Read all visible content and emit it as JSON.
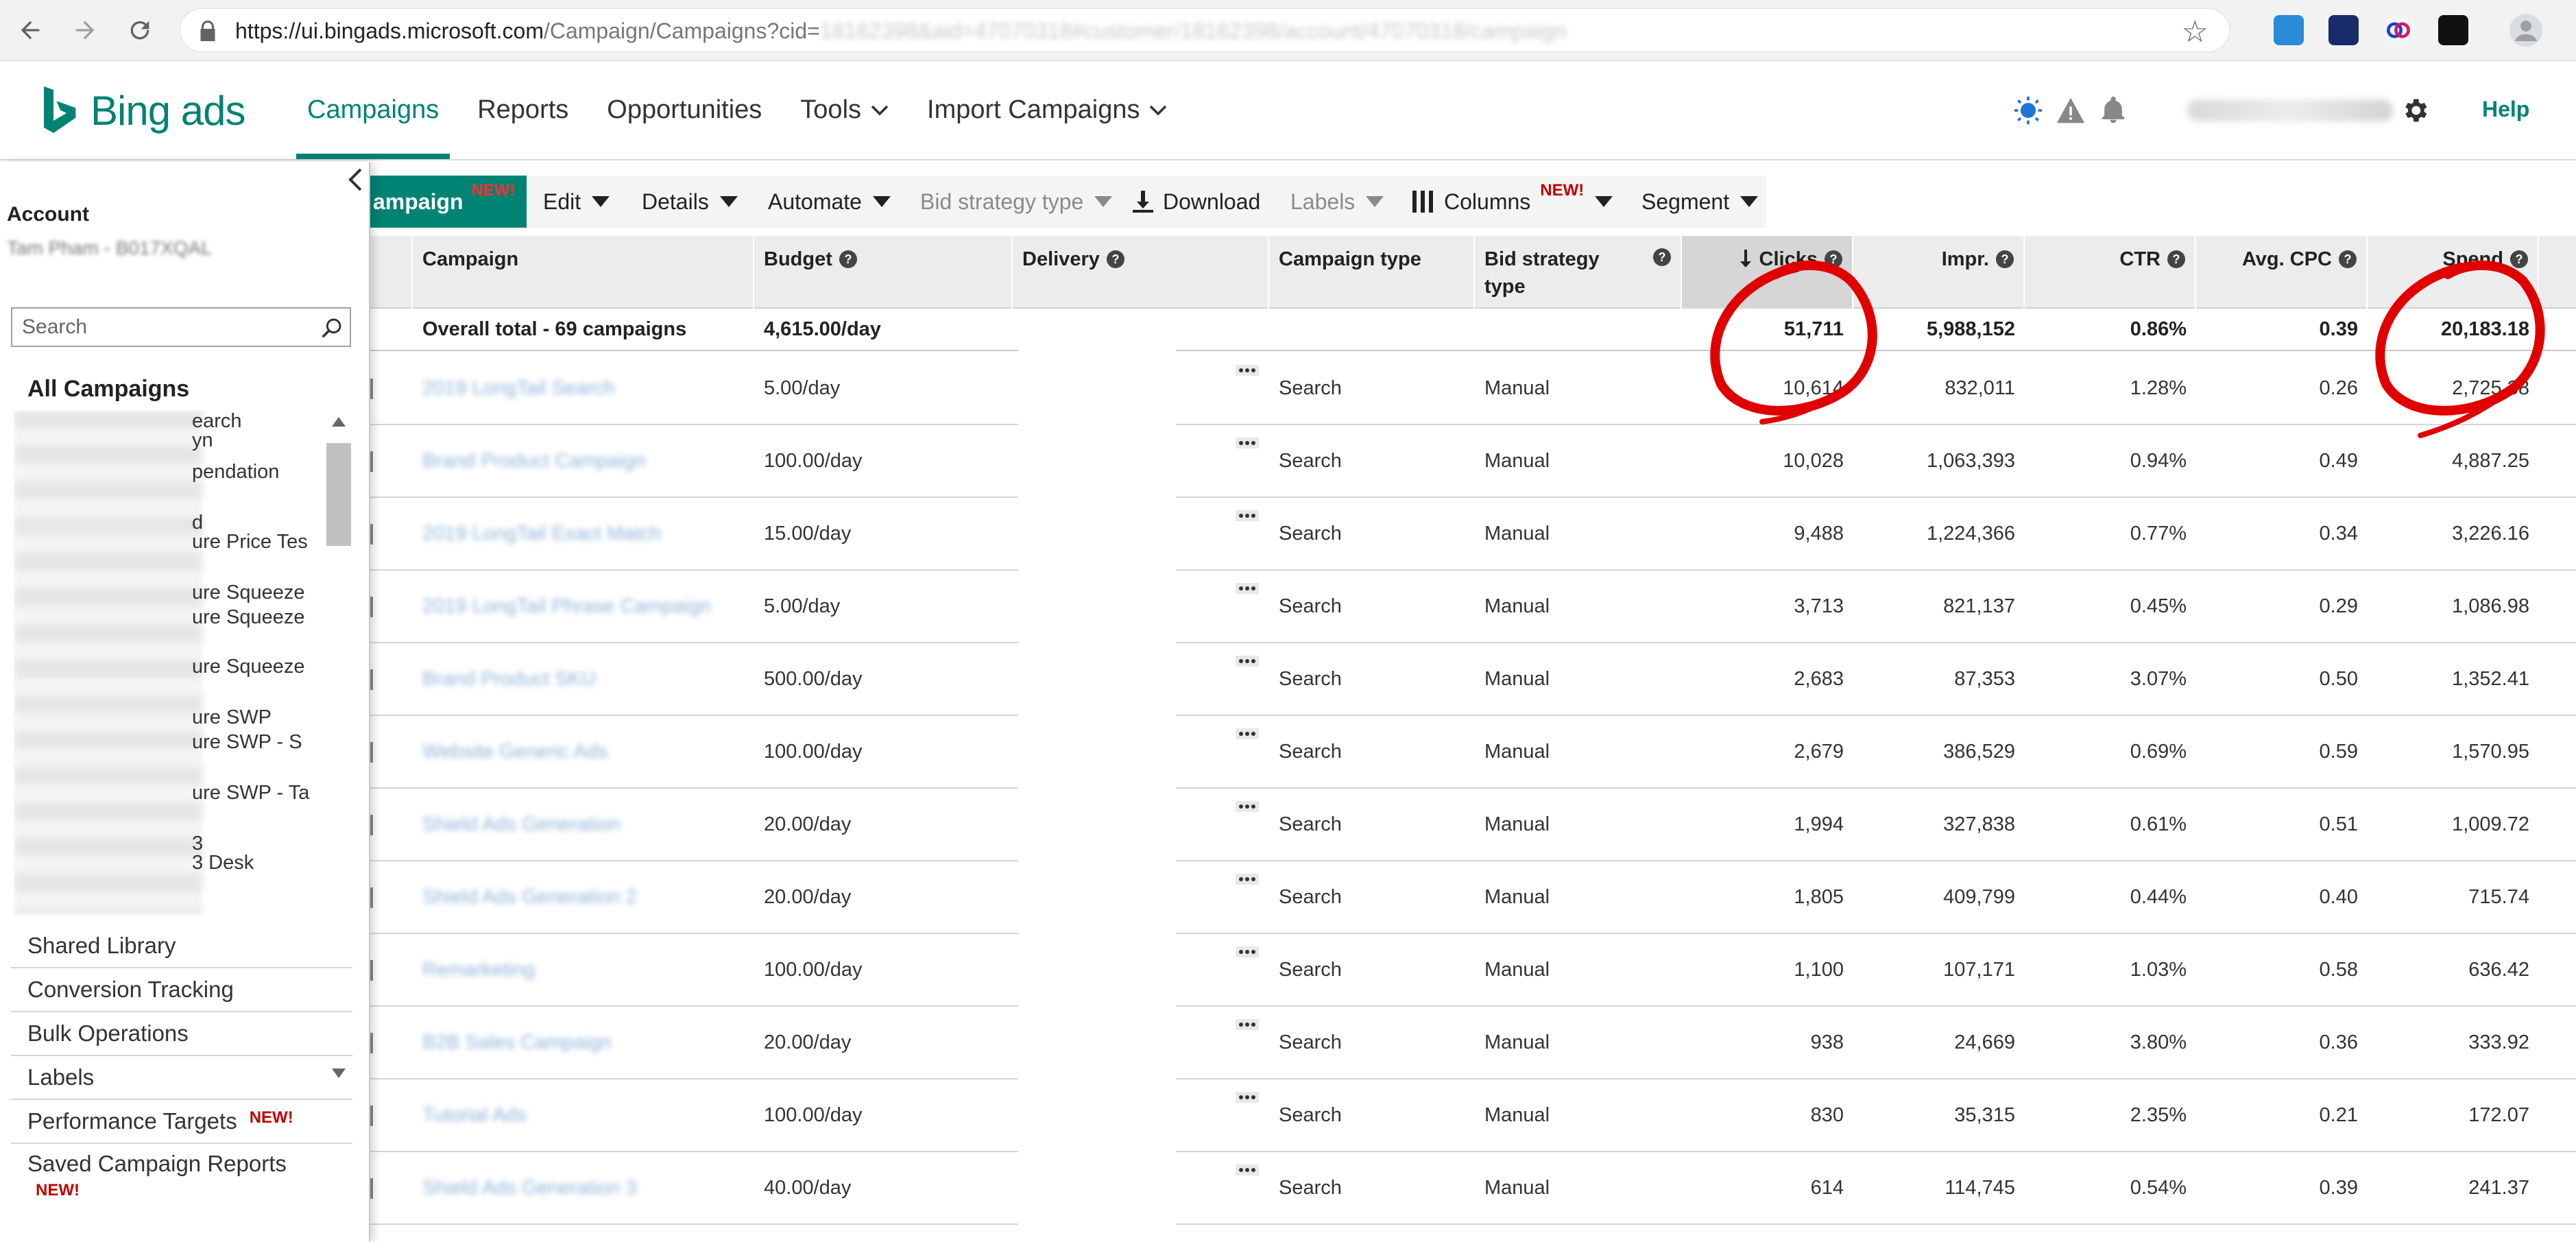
{
  "browser": {
    "url_main": "https://ui.bingads.microsoft.com",
    "url_path": "/Campaign/Campaigns?cid=",
    "url_blurred": "18162398&aid=47070318#customer/18162398/account/47070318/campaign"
  },
  "header": {
    "brand": "Bing ads",
    "nav": [
      {
        "label": "Campaigns"
      },
      {
        "label": "Reports"
      },
      {
        "label": "Opportunities"
      },
      {
        "label": "Tools"
      },
      {
        "label": "Import Campaigns"
      }
    ],
    "help": "Help"
  },
  "sidebar": {
    "account_label": "Account",
    "account_name": "Tam Pham - B017XQAL",
    "search_placeholder": "Search",
    "all_campaigns": "All Campaigns",
    "campaign_fragments": [
      "earch",
      "yn",
      "pendation",
      "d",
      "ure Price Tes",
      "ure Squeeze",
      "ure Squeeze",
      "ure Squeeze",
      "ure SWP",
      "ure SWP - S",
      "ure SWP - Ta",
      "3",
      "3 Desk"
    ],
    "menu": [
      {
        "label": "Shared Library"
      },
      {
        "label": "Conversion Tracking"
      },
      {
        "label": "Bulk Operations"
      },
      {
        "label": "Labels"
      },
      {
        "label": "Performance Targets",
        "badge": "NEW!"
      },
      {
        "label": "Saved Campaign Reports",
        "badge": "NEW!"
      }
    ]
  },
  "toolbar": {
    "create_label": "ampaign",
    "create_badge": "NEW!",
    "edit": "Edit",
    "details": "Details",
    "automate": "Automate",
    "bid_strategy": "Bid strategy type",
    "download": "Download",
    "labels": "Labels",
    "columns": "Columns",
    "columns_badge": "NEW!",
    "segment": "Segment"
  },
  "grid": {
    "headers": {
      "campaign": "Campaign",
      "budget": "Budget",
      "delivery": "Delivery",
      "campaign_type": "Campaign type",
      "bid_strategy_1": "Bid strategy",
      "bid_strategy_2": "type",
      "clicks": "Clicks",
      "impr": "Impr.",
      "ctr": "CTR",
      "avg_cpc": "Avg. CPC",
      "spend": "Spend"
    },
    "total": {
      "label": "Overall total - 69 campaigns",
      "budget": "4,615.00/day",
      "clicks": "51,711",
      "impr": "5,988,152",
      "ctr": "0.86%",
      "cpc": "0.39",
      "spend": "20,183.18"
    },
    "rows": [
      {
        "name": "2019 LongTail Search",
        "budget": "5.00/day",
        "type": "Search",
        "bid": "Manual",
        "clicks": "10,614",
        "impr": "832,011",
        "ctr": "1.28%",
        "cpc": "0.26",
        "spend": "2,725.38"
      },
      {
        "name": "Brand Product Campaign",
        "budget": "100.00/day",
        "type": "Search",
        "bid": "Manual",
        "clicks": "10,028",
        "impr": "1,063,393",
        "ctr": "0.94%",
        "cpc": "0.49",
        "spend": "4,887.25"
      },
      {
        "name": "2019 LongTail Exact Match",
        "budget": "15.00/day",
        "type": "Search",
        "bid": "Manual",
        "clicks": "9,488",
        "impr": "1,224,366",
        "ctr": "0.77%",
        "cpc": "0.34",
        "spend": "3,226.16"
      },
      {
        "name": "2019 LongTail Phrase Campaign",
        "budget": "5.00/day",
        "type": "Search",
        "bid": "Manual",
        "clicks": "3,713",
        "impr": "821,137",
        "ctr": "0.45%",
        "cpc": "0.29",
        "spend": "1,086.98"
      },
      {
        "name": "Brand Product SKU",
        "budget": "500.00/day",
        "type": "Search",
        "bid": "Manual",
        "clicks": "2,683",
        "impr": "87,353",
        "ctr": "3.07%",
        "cpc": "0.50",
        "spend": "1,352.41"
      },
      {
        "name": "Website Generic Ads",
        "budget": "100.00/day",
        "type": "Search",
        "bid": "Manual",
        "clicks": "2,679",
        "impr": "386,529",
        "ctr": "0.69%",
        "cpc": "0.59",
        "spend": "1,570.95"
      },
      {
        "name": "Shield Ads Generation",
        "budget": "20.00/day",
        "type": "Search",
        "bid": "Manual",
        "clicks": "1,994",
        "impr": "327,838",
        "ctr": "0.61%",
        "cpc": "0.51",
        "spend": "1,009.72"
      },
      {
        "name": "Shield Ads Generation 2",
        "budget": "20.00/day",
        "type": "Search",
        "bid": "Manual",
        "clicks": "1,805",
        "impr": "409,799",
        "ctr": "0.44%",
        "cpc": "0.40",
        "spend": "715.74"
      },
      {
        "name": "Remarketing",
        "budget": "100.00/day",
        "type": "Search",
        "bid": "Manual",
        "clicks": "1,100",
        "impr": "107,171",
        "ctr": "1.03%",
        "cpc": "0.58",
        "spend": "636.42"
      },
      {
        "name": "B2B Sales Campaign",
        "budget": "20.00/day",
        "type": "Search",
        "bid": "Manual",
        "clicks": "938",
        "impr": "24,669",
        "ctr": "3.80%",
        "cpc": "0.36",
        "spend": "333.92"
      },
      {
        "name": "Tutorial Ads",
        "budget": "100.00/day",
        "type": "Search",
        "bid": "Manual",
        "clicks": "830",
        "impr": "35,315",
        "ctr": "2.35%",
        "cpc": "0.21",
        "spend": "172.07"
      },
      {
        "name": "Shield Ads Generation 3",
        "budget": "40.00/day",
        "type": "Search",
        "bid": "Manual",
        "clicks": "614",
        "impr": "114,745",
        "ctr": "0.54%",
        "cpc": "0.39",
        "spend": "241.37"
      }
    ]
  },
  "colors": {
    "brand": "#008373",
    "annotation": "#e00000",
    "new_badge": "#c00000"
  }
}
